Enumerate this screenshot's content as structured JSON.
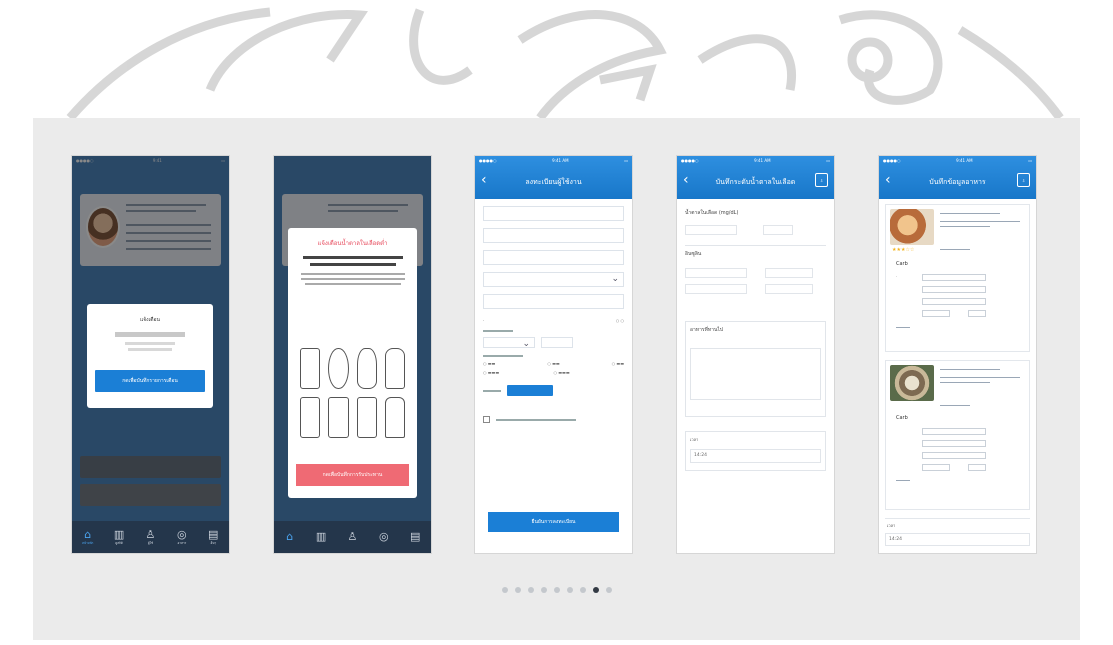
{
  "colors": {
    "accent": "#1e88d8",
    "danger_button": "#ef6a74",
    "gallery_bg": "#ebebeb",
    "dot_active": "#333a44",
    "dot_inactive": "#c4c8cd"
  },
  "pager": {
    "count": 9,
    "active_index": 7
  },
  "phones": [
    {
      "screen": "home-alert",
      "modal": {
        "title": "แจ้งเตือน",
        "button_label": "กดเพื่อบันทึกรายการเตือน"
      },
      "tabs": [
        {
          "label": "หน้าหลัก",
          "icon": "home-icon"
        },
        {
          "label": "ดูสถิติ",
          "icon": "chart-icon"
        },
        {
          "label": "ผู้ใช้",
          "icon": "user-icon"
        },
        {
          "label": "อาหาร",
          "icon": "food-icon"
        },
        {
          "label": "อื่นๆ",
          "icon": "more-icon"
        }
      ]
    },
    {
      "screen": "home-sugar-modal",
      "modal": {
        "title": "แจ้งเตือนน้ำตาลในเลือดต่ำ",
        "button_label": "กดเพื่อบันทึกการรับประทาน"
      }
    },
    {
      "screen": "register",
      "title": "ลงทะเบียนผู้ใช้งาน",
      "submit_label": "ยืนยันการลงทะเบียน"
    },
    {
      "screen": "blood-sugar-record",
      "title": "บันทึกระดับน้ำตาลในเลือด",
      "field_label": "น้ำตาลในเลือด (mg/dL)",
      "section_insulin": "อินซูลิน",
      "section_food": "อาหารที่ทานไป",
      "time_label": "เวลา",
      "time_value": "14:24"
    },
    {
      "screen": "food-record",
      "title": "บันทึกข้อมูลอาหาร",
      "carb_label": "Carb",
      "time_label": "เวลา",
      "time_value": "14:24"
    }
  ]
}
